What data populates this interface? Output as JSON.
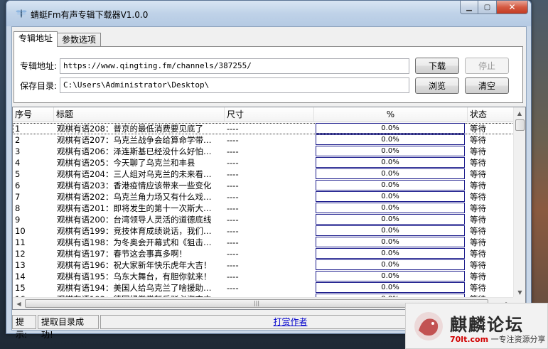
{
  "window": {
    "title": "蜻蜓Fm有声专辑下载器V1.0.0"
  },
  "tabs": [
    {
      "label": "专辑地址"
    },
    {
      "label": "参数选项"
    }
  ],
  "form": {
    "url_label": "专辑地址:",
    "url_value": "https://www.qingting.fm/channels/387255/",
    "dir_label": "保存目录:",
    "dir_value": "C:\\Users\\Administrator\\Desktop\\",
    "download_label": "下载",
    "stop_label": "停止",
    "browse_label": "浏览",
    "clear_label": "清空"
  },
  "list": {
    "columns": [
      "序号",
      "标题",
      "尺寸",
      "%",
      "状态"
    ],
    "rows": [
      {
        "no": "1",
        "title": "观棋有语208：普京的最低消费要见底了",
        "size": "----",
        "progress": "0.0%",
        "status": "等待"
      },
      {
        "no": "2",
        "title": "观棋有语207：乌克兰战争会给算命学带…",
        "size": "----",
        "progress": "0.0%",
        "status": "等待"
      },
      {
        "no": "3",
        "title": "观棋有语206：泽连斯基已经没什么好怕…",
        "size": "----",
        "progress": "0.0%",
        "status": "等待"
      },
      {
        "no": "4",
        "title": "观棋有语205：今天聊了乌克兰和丰县",
        "size": "----",
        "progress": "0.0%",
        "status": "等待"
      },
      {
        "no": "5",
        "title": "观棋有语204：三人组对乌克兰的未来看…",
        "size": "----",
        "progress": "0.0%",
        "status": "等待"
      },
      {
        "no": "6",
        "title": "观棋有语203：香港疫情应该带来一些变化",
        "size": "----",
        "progress": "0.0%",
        "status": "等待"
      },
      {
        "no": "7",
        "title": "观棋有语202：乌克兰角力场又有什么戏…",
        "size": "----",
        "progress": "0.0%",
        "status": "等待"
      },
      {
        "no": "8",
        "title": "观棋有语201：即将发生的第十一次斯大…",
        "size": "----",
        "progress": "0.0%",
        "status": "等待"
      },
      {
        "no": "9",
        "title": "观棋有语200：台湾领导人灵活的道德底线",
        "size": "----",
        "progress": "0.0%",
        "status": "等待"
      },
      {
        "no": "10",
        "title": "观棋有语199：竞技体育成绩说话，我们…",
        "size": "----",
        "progress": "0.0%",
        "status": "等待"
      },
      {
        "no": "11",
        "title": "观棋有语198：为冬奥会开幕式和《狙击…",
        "size": "----",
        "progress": "0.0%",
        "status": "等待"
      },
      {
        "no": "12",
        "title": "观棋有语197：春节这会事真多啊！",
        "size": "----",
        "progress": "0.0%",
        "status": "等待"
      },
      {
        "no": "13",
        "title": "观棋有语196：祝大家新年快乐虎年大吉！",
        "size": "----",
        "progress": "0.0%",
        "status": "等待"
      },
      {
        "no": "14",
        "title": "观棋有语195：乌东大舞台，有胆你就来！",
        "size": "----",
        "progress": "0.0%",
        "status": "等待"
      },
      {
        "no": "15",
        "title": "观棋有语194：美国人给乌克兰了啥援助…",
        "size": "----",
        "progress": "0.0%",
        "status": "等待"
      },
      {
        "no": "16",
        "title": "观棋有语193：德国绿党党魁反驳必姿态立…",
        "size": "----",
        "progress": "0.0%",
        "status": "等待"
      }
    ]
  },
  "statusbar": {
    "label": "提示:",
    "message": "提取目录成功!",
    "link": "打赏作者"
  },
  "watermark": {
    "name": "麒麟论坛",
    "site": "70lt.com",
    "slogan": "一专注资源分享"
  }
}
